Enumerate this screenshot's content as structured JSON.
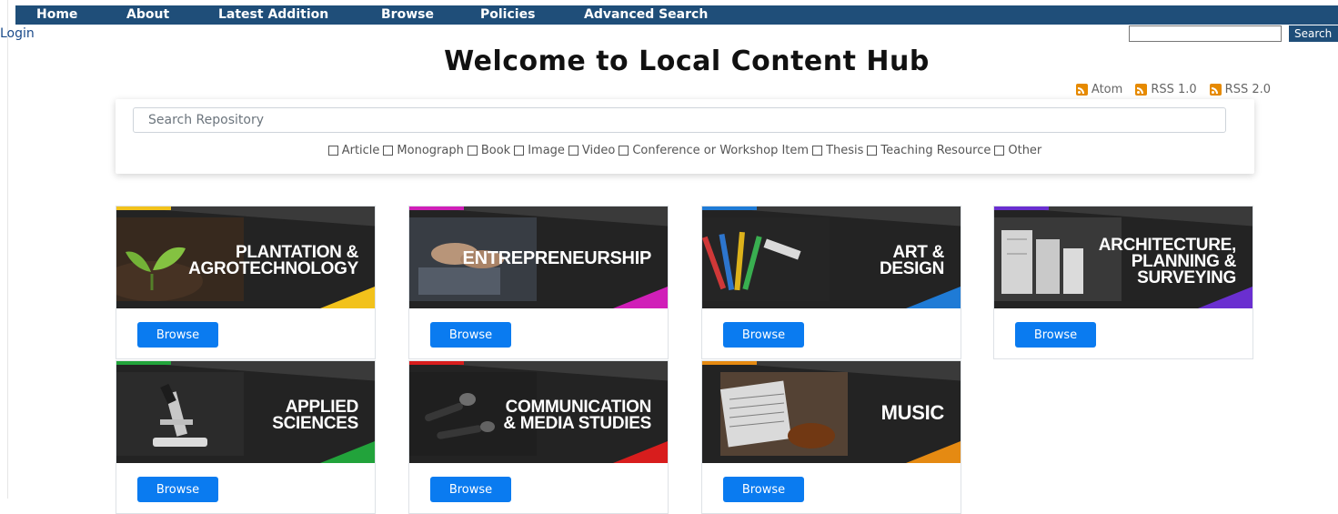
{
  "nav": {
    "items": [
      {
        "label": "Home"
      },
      {
        "label": "About"
      },
      {
        "label": "Latest Addition"
      },
      {
        "label": "Browse"
      },
      {
        "label": "Policies"
      },
      {
        "label": "Advanced Search"
      }
    ],
    "login_label": "Login",
    "search_button": "Search",
    "search_value": ""
  },
  "page": {
    "title": "Welcome to Local Content Hub"
  },
  "feeds": [
    {
      "label": "Atom",
      "icon": "rss-icon"
    },
    {
      "label": "RSS 1.0",
      "icon": "rss-icon"
    },
    {
      "label": "RSS 2.0",
      "icon": "rss-icon"
    }
  ],
  "search": {
    "placeholder": "Search Repository",
    "types": [
      "Article",
      "Monograph",
      "Book",
      "Image",
      "Video",
      "Conference or Workshop Item",
      "Thesis",
      "Teaching Resource",
      "Other"
    ]
  },
  "categories": [
    {
      "caption_line1": "PLANTATION &",
      "caption_line2": "AGROTECHNOLOGY",
      "caption_line3": "",
      "accent": "#f2c21b",
      "photo": "seedling",
      "browse_label": "Browse"
    },
    {
      "caption_line1": "ENTREPRENEURSHIP",
      "caption_line2": "",
      "caption_line3": "",
      "accent": "#d01fb8",
      "photo": "handshake",
      "browse_label": "Browse"
    },
    {
      "caption_line1": "ART &",
      "caption_line2": "DESIGN",
      "caption_line3": "",
      "accent": "#1f7bd6",
      "photo": "paint-brushes",
      "browse_label": "Browse"
    },
    {
      "caption_line1": "ARCHITECTURE,",
      "caption_line2": "PLANNING &",
      "caption_line3": "SURVEYING",
      "accent": "#6a2fd0",
      "photo": "blueprints",
      "browse_label": "Browse"
    },
    {
      "caption_line1": "APPLIED",
      "caption_line2": "SCIENCES",
      "caption_line3": "",
      "accent": "#22a33b",
      "photo": "microscope",
      "browse_label": "Browse"
    },
    {
      "caption_line1": "COMMUNICATION",
      "caption_line2": "& MEDIA STUDIES",
      "caption_line3": "",
      "accent": "#d81d1d",
      "photo": "microphones",
      "browse_label": "Browse"
    },
    {
      "caption_line1": "MUSIC",
      "caption_line2": "",
      "caption_line3": "",
      "accent": "#e58a12",
      "photo": "sheet-music",
      "browse_label": "Browse"
    }
  ],
  "colors": {
    "nav_bg": "#1f4e79",
    "browse_button": "#0a7bf0",
    "feed_icon": "#e68a00"
  }
}
